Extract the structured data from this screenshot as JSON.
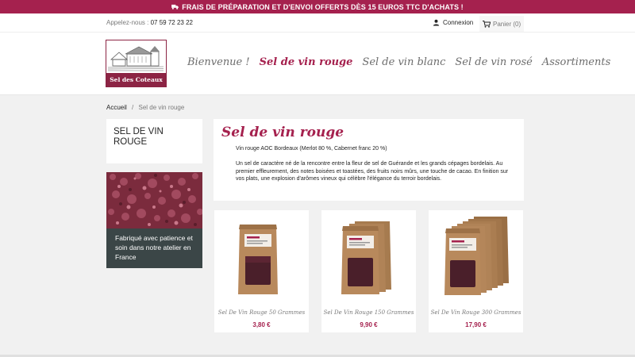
{
  "promo_bar": {
    "text": "FRAIS DE PRÉPARATION ET D'ENVOI OFFERTS DÈS 15 EUROS TTC D'ACHATS !"
  },
  "header": {
    "phone_label": "Appelez-nous :",
    "phone_number": "07 59 72 23 22",
    "login_label": "Connexion",
    "cart_label": "Panier (0)"
  },
  "logo": {
    "text": "Sel des Coteaux"
  },
  "nav": {
    "items": [
      {
        "label": "Bienvenue !"
      },
      {
        "label": "Sel de vin rouge"
      },
      {
        "label": "Sel de vin blanc"
      },
      {
        "label": "Sel de vin rosé"
      },
      {
        "label": "Assortiments"
      }
    ]
  },
  "breadcrumb": {
    "home": "Accueil",
    "separator": "/",
    "current": "Sel de vin rouge"
  },
  "sidebar": {
    "title": "SEL DE VIN ROUGE",
    "promo_text": "Fabriqué avec patience et soin dans notre atelier en France"
  },
  "category": {
    "title": "Sel de vin rouge",
    "subtitle": "Vin rouge AOC Bordeaux (Merlot 80 %, Cabernet franc 20 %)",
    "description": "Un sel de caractère né de la rencontre entre la fleur de sel de Guérande et les grands cépages bordelais. Au premier effleurement, des notes boisées et toastées, des fruits noirs mûrs, une touche de cacao. En finition sur vos plats, une explosion d'arômes vineux qui célèbre l'élégance du terroir bordelais."
  },
  "products": [
    {
      "name": "Sel De Vin Rouge 50 Grammes",
      "price": "3,80 €",
      "bags": 1
    },
    {
      "name": "Sel De Vin Rouge 150 Grammes",
      "price": "9,90 €",
      "bags": 3
    },
    {
      "name": "Sel De Vin Rouge 300 Grammes",
      "price": "17,90 €",
      "bags": 6
    }
  ],
  "colors": {
    "accent": "#a5214e",
    "caption_bg": "#3b4647"
  }
}
